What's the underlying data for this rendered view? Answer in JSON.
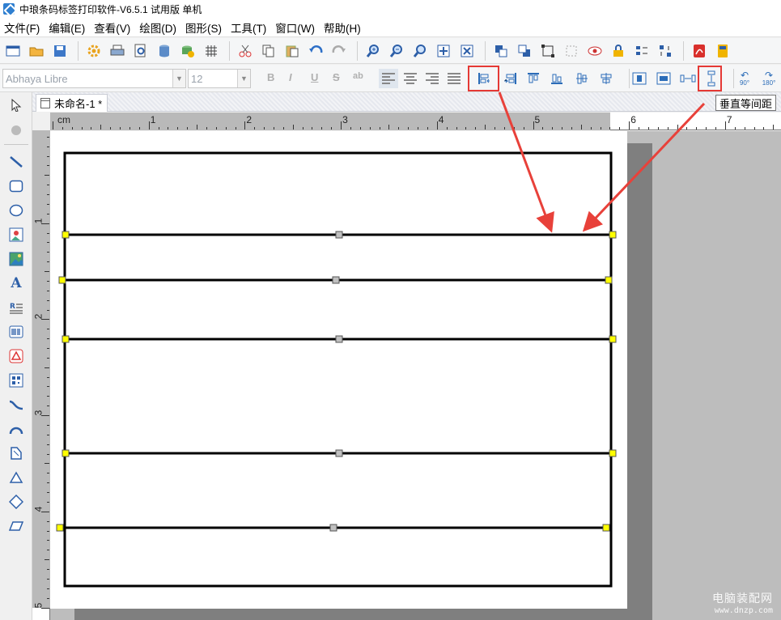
{
  "app": {
    "title": "中琅条码标签打印软件-V6.5.1 试用版 单机"
  },
  "menu": {
    "items": [
      "文件(F)",
      "编辑(E)",
      "查看(V)",
      "绘图(D)",
      "图形(S)",
      "工具(T)",
      "窗口(W)",
      "帮助(H)"
    ]
  },
  "toolbar1": {
    "icons": [
      "new-icon",
      "open-icon",
      "save-icon",
      "settings-icon",
      "print-icon",
      "print-preview-icon",
      "database-icon",
      "database-settings-icon",
      "grid-icon",
      "cut-icon",
      "copy-icon",
      "paste-icon",
      "undo-icon",
      "redo-icon",
      "zoom-in-icon",
      "zoom-out-icon",
      "zoom-icon",
      "fit-page-icon",
      "fit-width-icon",
      "bring-front-icon",
      "send-back-icon",
      "group-icon",
      "ungroup-icon",
      "preview-eye-icon",
      "lock-icon",
      "align-objects-icon",
      "distribute-icon",
      "pdf-icon",
      "calculator-icon"
    ]
  },
  "format_bar": {
    "font_name": "Abhaya Libre",
    "font_size": "12",
    "bold": "B",
    "italic": "I",
    "underline": "U",
    "strike": "S",
    "other": "ab"
  },
  "arrange_bar": {
    "icons": [
      "align-left-icon",
      "align-right-icon",
      "align-top-icon",
      "align-bottom-icon",
      "align-center-vertical-icon",
      "align-center-horizontal-icon",
      "center-horizontal-page-icon",
      "center-vertical-page-icon",
      "horizontal-equal-spacing-icon",
      "vertical-equal-spacing-icon",
      "rotate-90-icon",
      "rotate-180-icon"
    ],
    "rotate_90": "90°",
    "rotate_180": "180°",
    "tooltip": "垂直等间距"
  },
  "toolbox": {
    "icons": [
      "select-arrow-icon",
      "pan-hand-icon",
      "line-icon",
      "rounded-rectangle-icon",
      "ellipse-icon",
      "picture-icon",
      "image-icon",
      "text-icon",
      "rich-text-icon",
      "barcode-icon",
      "qr-shape-icon",
      "two-dimensional-code-icon",
      "curve-icon",
      "arc-icon",
      "polygon-icon",
      "triangle-icon",
      "diamond-icon",
      "parallelogram-icon"
    ]
  },
  "document": {
    "tab_label": "未命名-1 *"
  },
  "ruler": {
    "unit": "cm",
    "h_labels": [
      "1",
      "2",
      "3",
      "4",
      "5",
      "6",
      "7"
    ],
    "v_labels": [
      "1",
      "2",
      "3",
      "4",
      "5"
    ]
  },
  "watermark": {
    "line1": "电脑装配网",
    "line2": "www.dnzp.com"
  },
  "colors": {
    "highlight": "#e53935",
    "selection_handle": "#ffff00",
    "center_handle": "#c0c0c0"
  }
}
